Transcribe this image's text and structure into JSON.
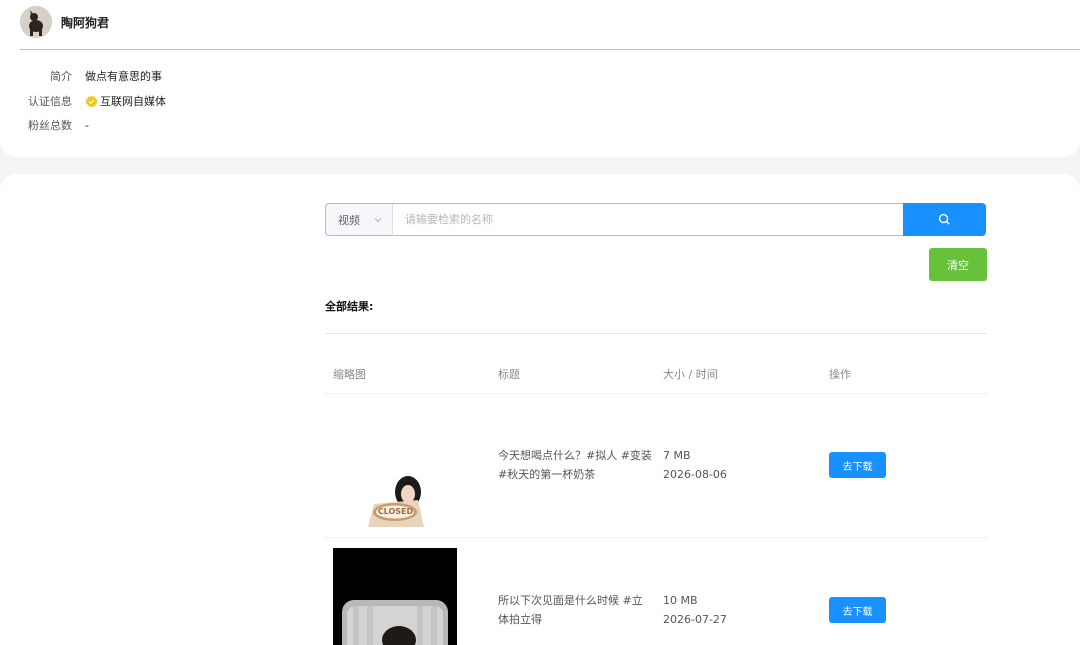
{
  "profile": {
    "username": "陶阿狗君",
    "info": [
      {
        "label": "简介",
        "value": "做点有意思的事"
      },
      {
        "label": "认证信息",
        "value": "互联网自媒体"
      },
      {
        "label": "粉丝总数",
        "value": "-"
      }
    ]
  },
  "search": {
    "select_value": "视频",
    "placeholder": "请输要检索的名称",
    "clear_label": "清空"
  },
  "results": {
    "title": "全部结果:",
    "columns": [
      "缩略图",
      "标题",
      "大小 / 时间",
      "操作"
    ],
    "rows": [
      {
        "thumbnail_text": "CLOSED",
        "title": "今天想喝点什么？#拟人 #变装 #秋天的第一杯奶茶",
        "size": "7 MB",
        "date": "2026-08-06",
        "action": "去下载"
      },
      {
        "title": "所以下次见面是什么时候 #立体拍立得",
        "size": "10 MB",
        "date": "2026-07-27",
        "action": "去下载"
      }
    ]
  },
  "colors": {
    "primary": "#1890ff",
    "success": "#67c23a",
    "verified": "#f5c518"
  },
  "icons": {
    "search": "search-icon",
    "select": "chevron-down-icon",
    "verified": "verified-badge-icon"
  }
}
